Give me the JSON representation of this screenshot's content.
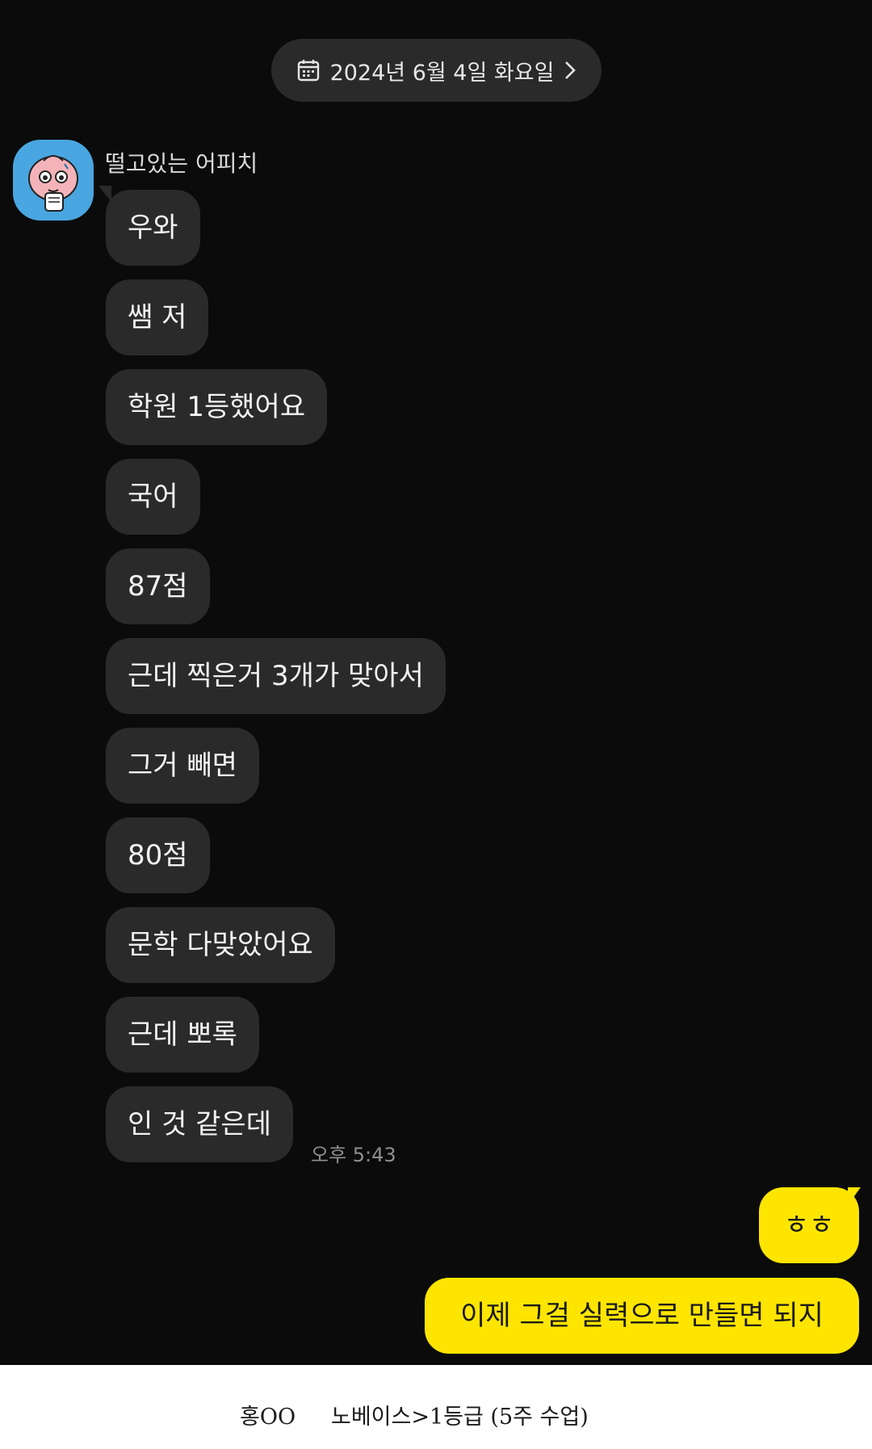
{
  "date_header": {
    "label": "2024년 6월 4일 화요일",
    "icon": "calendar-icon",
    "arrow_icon": "chevron-right-icon"
  },
  "sender": {
    "name": "떨고있는 어피치",
    "avatar_icon": "apeach-avatar-icon"
  },
  "incoming": [
    "우와",
    "쌤 저",
    "학원 1등했어요",
    "국어",
    "87점",
    "근데 찍은거 3개가 맞아서",
    "그거 빼면",
    "80점",
    "문학 다맞았어요",
    "근데 뽀록",
    "인 것 같은데"
  ],
  "incoming_time": "오후 5:43",
  "outgoing": [
    "ㅎㅎ",
    "이제 그걸 실력으로 만들면 되지"
  ],
  "caption": {
    "name": "홍OO",
    "description": "노베이스>1등급 (5주 수업)"
  },
  "colors": {
    "background": "#0b0b0b",
    "incoming_bubble": "#2a2a2a",
    "outgoing_bubble": "#fee500",
    "avatar_bg": "#49a6e0"
  }
}
